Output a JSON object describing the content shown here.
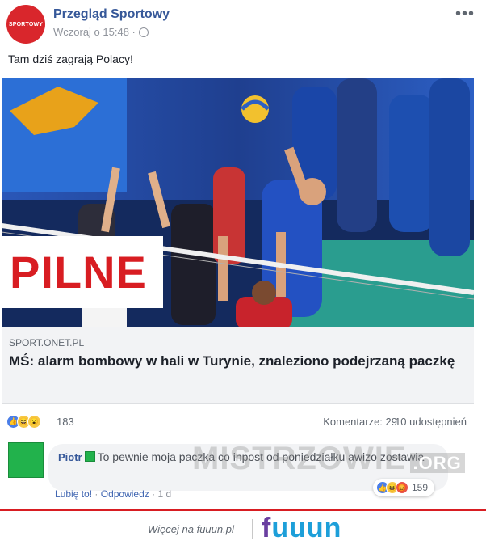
{
  "post": {
    "page_name": "Przegląd Sportowy",
    "avatar_label": "SPORTOWY",
    "timestamp": "Wczoraj o 15:48 ·",
    "more_icon": "more-icon",
    "text": "Tam dziś zagrają Polacy!"
  },
  "link_card": {
    "image_overlay": "PILNE",
    "domain": "SPORT.ONET.PL",
    "title": "MŚ: alarm bombowy w hali w Turynie, znaleziono podejrzaną paczkę"
  },
  "reactions": {
    "count": "183",
    "comments": "Komentarze: 29",
    "shares": "10 udostępnień"
  },
  "comment": {
    "author": "Piotr",
    "text": "To pewnie moja paczka co inpost od poniedziałku awizo zostawia",
    "watermark": "MISTRZOWIE",
    "watermark_suffix": ".ORG",
    "like_label": "Lubię to!",
    "reply_label": "Odpowiedz",
    "age": "1 d",
    "reaction_count": "159"
  },
  "footer": {
    "text": "Więcej na fuuun.pl",
    "logo": "fuuun",
    "colors": {
      "accent": "#d81d22",
      "logo_f": "#6a3fa0",
      "logo_u": "#1d9fd9"
    }
  }
}
